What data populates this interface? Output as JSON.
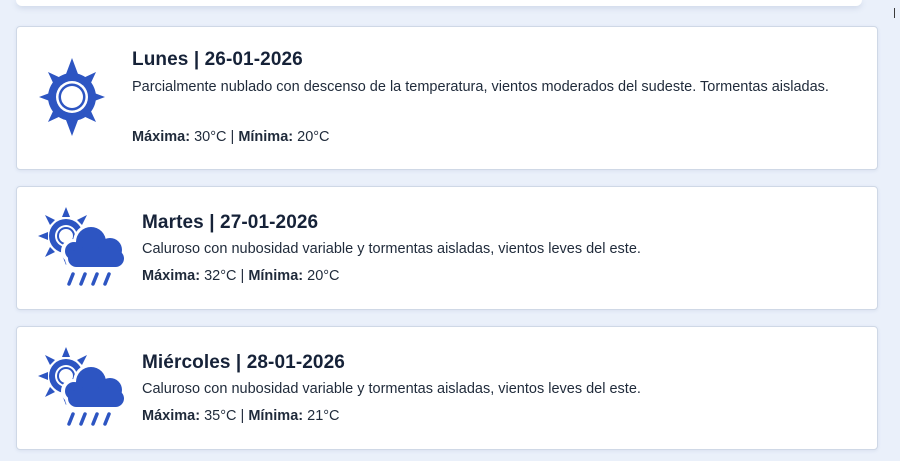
{
  "forecast": [
    {
      "title": "Lunes | 26-01-2026",
      "description": "Parcialmente nublado con descenso de la temperatura, vientos moderados del sudeste. Tormentas aisladas.",
      "max_label": "Máxima:",
      "max_value": "30°C",
      "separator": "|",
      "min_label": "Mínima:",
      "min_value": "20°C",
      "icon": "sun-icon"
    },
    {
      "title": "Martes | 27-01-2026",
      "description": "Caluroso con nubosidad variable y tormentas aisladas, vientos leves del este.",
      "max_label": "Máxima:",
      "max_value": "32°C",
      "separator": "|",
      "min_label": "Mínima:",
      "min_value": "20°C",
      "icon": "sun-cloud-rain-icon"
    },
    {
      "title": "Miércoles | 28-01-2026",
      "description": "Caluroso con nubosidad variable y tormentas aisladas, vientos leves del este.",
      "max_label": "Máxima:",
      "max_value": "35°C",
      "separator": "|",
      "min_label": "Mínima:",
      "min_value": "21°C",
      "icon": "sun-cloud-rain-icon"
    }
  ],
  "colors": {
    "icon": "#2d55c2",
    "background": "#eaf0fa",
    "card": "#ffffff",
    "border": "#cfd8e6"
  }
}
